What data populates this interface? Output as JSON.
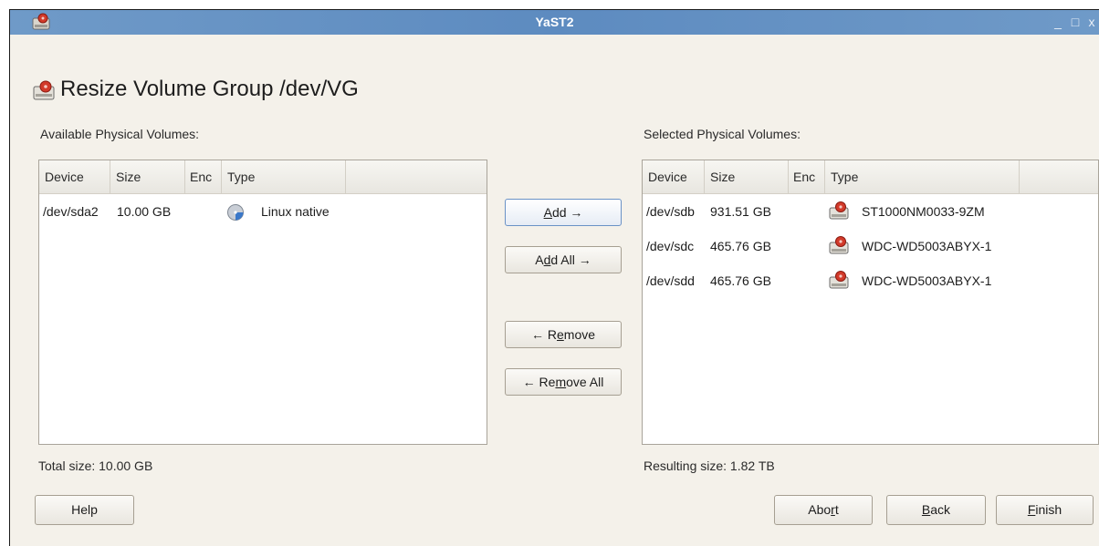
{
  "window": {
    "title": "YaST2",
    "minimize_glyph": "_",
    "maximize_glyph": "□",
    "close_glyph": "x"
  },
  "page": {
    "heading": "Resize Volume Group /dev/VG",
    "heading_icon": "harddisk-icon"
  },
  "available": {
    "label": "Available Physical Volumes:",
    "columns": [
      "Device",
      "Size",
      "Enc",
      "Type"
    ],
    "rows": [
      {
        "device": "/dev/sda2",
        "size": "10.00 GB",
        "enc": "",
        "type": "Linux native",
        "icon": "partition-icon"
      }
    ],
    "total_label": "Total size: 10.00 GB"
  },
  "selected": {
    "label": "Selected Physical Volumes:",
    "columns": [
      "Device",
      "Size",
      "Enc",
      "Type"
    ],
    "rows": [
      {
        "device": "/dev/sdb",
        "size": "931.51 GB",
        "enc": "",
        "type": "ST1000NM0033-9ZM",
        "icon": "harddisk-icon"
      },
      {
        "device": "/dev/sdc",
        "size": "465.76 GB",
        "enc": "",
        "type": "WDC-WD5003ABYX-1",
        "icon": "harddisk-icon"
      },
      {
        "device": "/dev/sdd",
        "size": "465.76 GB",
        "enc": "",
        "type": "WDC-WD5003ABYX-1",
        "icon": "harddisk-icon"
      }
    ],
    "resulting_label": "Resulting size: 1.82 TB"
  },
  "actions": {
    "add": {
      "pre": "",
      "u": "A",
      "post": "dd →"
    },
    "add_all": {
      "pre": "A",
      "u": "d",
      "post": "d All →"
    },
    "remove": {
      "pre": "← R",
      "u": "e",
      "post": "move"
    },
    "remove_all": {
      "pre": "← Re",
      "u": "m",
      "post": "ove All"
    }
  },
  "footer": {
    "help": "Help",
    "abort": {
      "pre": "Abo",
      "u": "r",
      "post": "t"
    },
    "back": {
      "pre": "",
      "u": "B",
      "post": "ack"
    },
    "finish": {
      "pre": "",
      "u": "F",
      "post": "inish"
    }
  }
}
